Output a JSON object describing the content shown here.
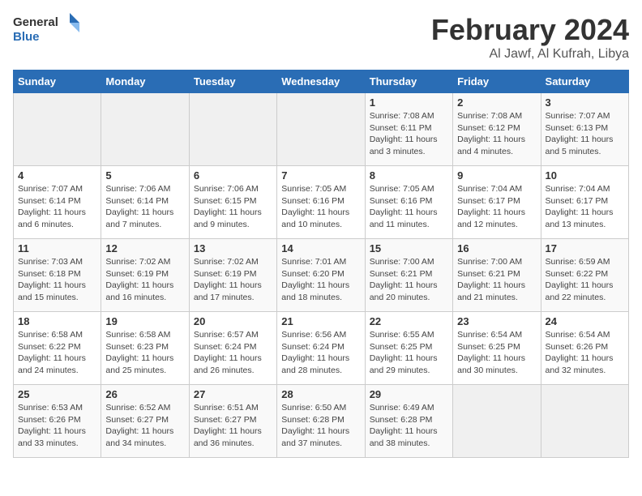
{
  "logo": {
    "text_general": "General",
    "text_blue": "Blue"
  },
  "title": {
    "month_year": "February 2024",
    "location": "Al Jawf, Al Kufrah, Libya"
  },
  "days_of_week": [
    "Sunday",
    "Monday",
    "Tuesday",
    "Wednesday",
    "Thursday",
    "Friday",
    "Saturday"
  ],
  "weeks": [
    [
      {
        "day": "",
        "info": ""
      },
      {
        "day": "",
        "info": ""
      },
      {
        "day": "",
        "info": ""
      },
      {
        "day": "",
        "info": ""
      },
      {
        "day": "1",
        "info": "Sunrise: 7:08 AM\nSunset: 6:11 PM\nDaylight: 11 hours and 3 minutes."
      },
      {
        "day": "2",
        "info": "Sunrise: 7:08 AM\nSunset: 6:12 PM\nDaylight: 11 hours and 4 minutes."
      },
      {
        "day": "3",
        "info": "Sunrise: 7:07 AM\nSunset: 6:13 PM\nDaylight: 11 hours and 5 minutes."
      }
    ],
    [
      {
        "day": "4",
        "info": "Sunrise: 7:07 AM\nSunset: 6:14 PM\nDaylight: 11 hours and 6 minutes."
      },
      {
        "day": "5",
        "info": "Sunrise: 7:06 AM\nSunset: 6:14 PM\nDaylight: 11 hours and 7 minutes."
      },
      {
        "day": "6",
        "info": "Sunrise: 7:06 AM\nSunset: 6:15 PM\nDaylight: 11 hours and 9 minutes."
      },
      {
        "day": "7",
        "info": "Sunrise: 7:05 AM\nSunset: 6:16 PM\nDaylight: 11 hours and 10 minutes."
      },
      {
        "day": "8",
        "info": "Sunrise: 7:05 AM\nSunset: 6:16 PM\nDaylight: 11 hours and 11 minutes."
      },
      {
        "day": "9",
        "info": "Sunrise: 7:04 AM\nSunset: 6:17 PM\nDaylight: 11 hours and 12 minutes."
      },
      {
        "day": "10",
        "info": "Sunrise: 7:04 AM\nSunset: 6:17 PM\nDaylight: 11 hours and 13 minutes."
      }
    ],
    [
      {
        "day": "11",
        "info": "Sunrise: 7:03 AM\nSunset: 6:18 PM\nDaylight: 11 hours and 15 minutes."
      },
      {
        "day": "12",
        "info": "Sunrise: 7:02 AM\nSunset: 6:19 PM\nDaylight: 11 hours and 16 minutes."
      },
      {
        "day": "13",
        "info": "Sunrise: 7:02 AM\nSunset: 6:19 PM\nDaylight: 11 hours and 17 minutes."
      },
      {
        "day": "14",
        "info": "Sunrise: 7:01 AM\nSunset: 6:20 PM\nDaylight: 11 hours and 18 minutes."
      },
      {
        "day": "15",
        "info": "Sunrise: 7:00 AM\nSunset: 6:21 PM\nDaylight: 11 hours and 20 minutes."
      },
      {
        "day": "16",
        "info": "Sunrise: 7:00 AM\nSunset: 6:21 PM\nDaylight: 11 hours and 21 minutes."
      },
      {
        "day": "17",
        "info": "Sunrise: 6:59 AM\nSunset: 6:22 PM\nDaylight: 11 hours and 22 minutes."
      }
    ],
    [
      {
        "day": "18",
        "info": "Sunrise: 6:58 AM\nSunset: 6:22 PM\nDaylight: 11 hours and 24 minutes."
      },
      {
        "day": "19",
        "info": "Sunrise: 6:58 AM\nSunset: 6:23 PM\nDaylight: 11 hours and 25 minutes."
      },
      {
        "day": "20",
        "info": "Sunrise: 6:57 AM\nSunset: 6:24 PM\nDaylight: 11 hours and 26 minutes."
      },
      {
        "day": "21",
        "info": "Sunrise: 6:56 AM\nSunset: 6:24 PM\nDaylight: 11 hours and 28 minutes."
      },
      {
        "day": "22",
        "info": "Sunrise: 6:55 AM\nSunset: 6:25 PM\nDaylight: 11 hours and 29 minutes."
      },
      {
        "day": "23",
        "info": "Sunrise: 6:54 AM\nSunset: 6:25 PM\nDaylight: 11 hours and 30 minutes."
      },
      {
        "day": "24",
        "info": "Sunrise: 6:54 AM\nSunset: 6:26 PM\nDaylight: 11 hours and 32 minutes."
      }
    ],
    [
      {
        "day": "25",
        "info": "Sunrise: 6:53 AM\nSunset: 6:26 PM\nDaylight: 11 hours and 33 minutes."
      },
      {
        "day": "26",
        "info": "Sunrise: 6:52 AM\nSunset: 6:27 PM\nDaylight: 11 hours and 34 minutes."
      },
      {
        "day": "27",
        "info": "Sunrise: 6:51 AM\nSunset: 6:27 PM\nDaylight: 11 hours and 36 minutes."
      },
      {
        "day": "28",
        "info": "Sunrise: 6:50 AM\nSunset: 6:28 PM\nDaylight: 11 hours and 37 minutes."
      },
      {
        "day": "29",
        "info": "Sunrise: 6:49 AM\nSunset: 6:28 PM\nDaylight: 11 hours and 38 minutes."
      },
      {
        "day": "",
        "info": ""
      },
      {
        "day": "",
        "info": ""
      }
    ]
  ]
}
